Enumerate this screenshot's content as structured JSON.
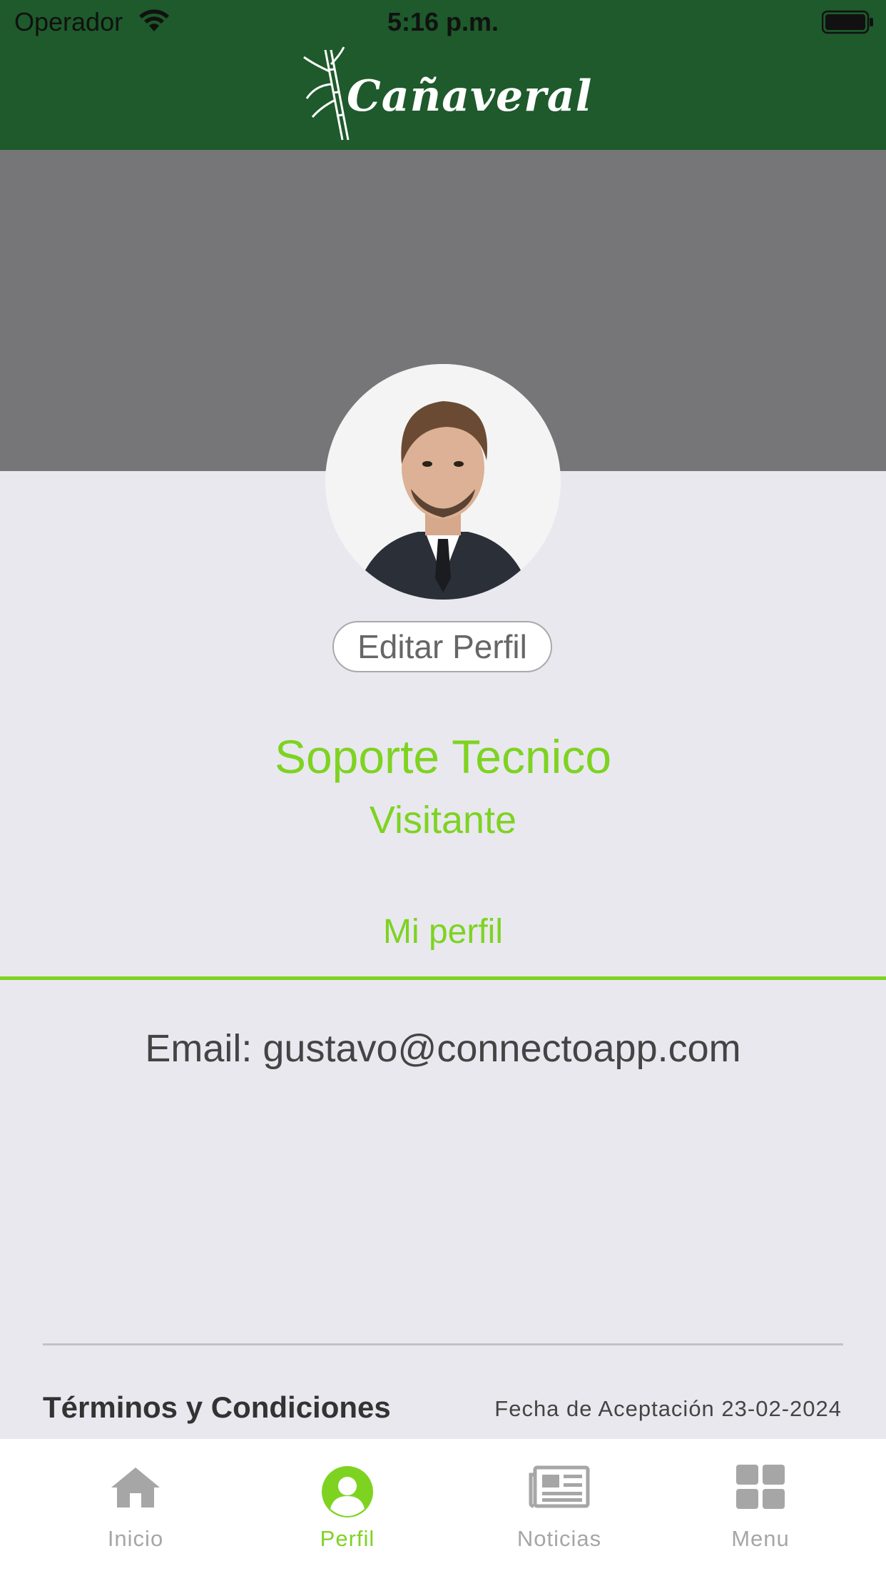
{
  "status_bar": {
    "carrier": "Operador",
    "time": "5:16 p.m."
  },
  "header": {
    "brand": "Cañaveral"
  },
  "colors": {
    "header_green": "#1e5a2b",
    "accent_green": "#7ed321",
    "cover_gray": "#767679",
    "background": "#e9e8ef"
  },
  "profile": {
    "edit_button": "Editar Perfil",
    "name": "Soporte Tecnico",
    "role": "Visitante",
    "section_tab": "Mi perfil",
    "email": "Email: gustavo@connectoapp.com"
  },
  "footer": {
    "terms": "Términos y Condiciones",
    "acceptance_date": "Fecha de Aceptación 23-02-2024"
  },
  "tabbar": {
    "items": [
      {
        "label": "Inicio",
        "icon": "home-icon",
        "active": false
      },
      {
        "label": "Perfil",
        "icon": "person-icon",
        "active": true
      },
      {
        "label": "Noticias",
        "icon": "newspaper-icon",
        "active": false
      },
      {
        "label": "Menu",
        "icon": "grid-icon",
        "active": false
      }
    ]
  }
}
